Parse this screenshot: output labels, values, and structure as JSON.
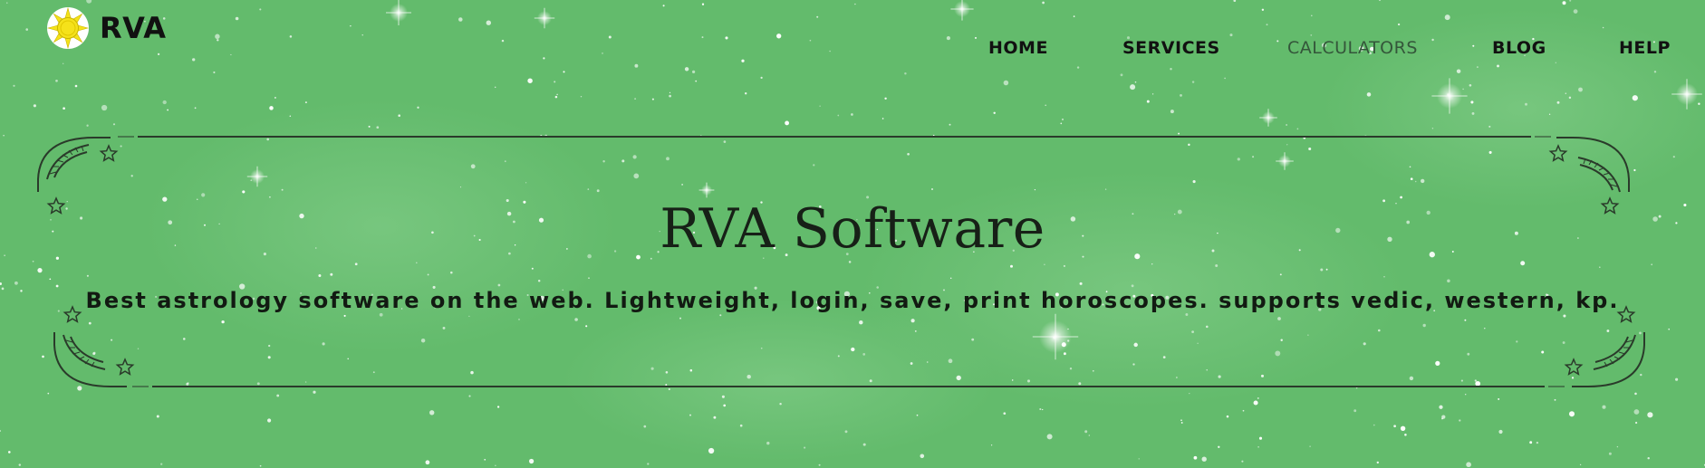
{
  "brand": {
    "name": "RVA",
    "icon": "sun-icon"
  },
  "nav": {
    "items": [
      {
        "label": "HOME",
        "active": false
      },
      {
        "label": "SERVICES",
        "active": false
      },
      {
        "label": "CALCULATORS",
        "active": true
      },
      {
        "label": "BLOG",
        "active": false
      },
      {
        "label": "HELP",
        "active": false
      }
    ]
  },
  "hero": {
    "title": "RVA Software",
    "subtitle": "Best astrology software on the web. Lightweight, login, save, print horoscopes. supports vedic, western, kp."
  },
  "colors": {
    "background": "#63bb6c",
    "accent_active_nav": "#34563a",
    "logo_sun": "#f5e21a",
    "text": "#111111"
  }
}
